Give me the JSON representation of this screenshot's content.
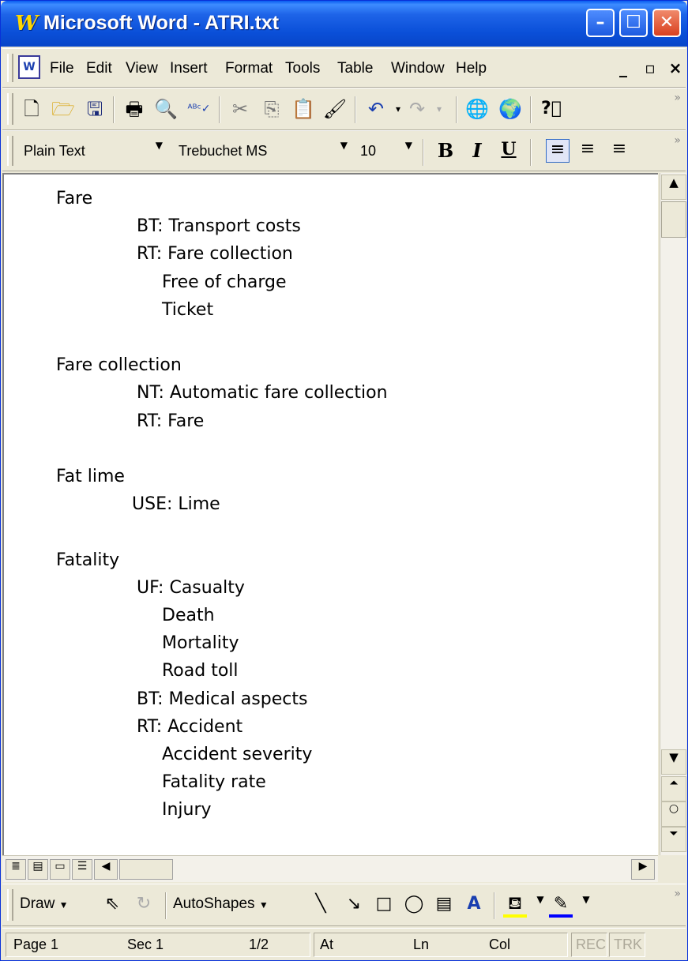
{
  "window": {
    "title": "Microsoft Word - ATRI.txt",
    "app_icon": "W",
    "controls": [
      "minimize-icon",
      "maximize-icon",
      "close-icon"
    ]
  },
  "menubar": {
    "doc_icon": "W",
    "items": [
      "File",
      "Edit",
      "View",
      "Insert",
      "Format",
      "Tools",
      "Table",
      "Window",
      "Help"
    ],
    "mdi_controls": [
      "_",
      "▫",
      "×"
    ]
  },
  "standard_toolbar": {
    "icons": [
      "new-icon",
      "open-icon",
      "save-icon",
      "print-icon",
      "print-preview-icon",
      "spelling-icon",
      "cut-icon",
      "copy-icon",
      "paste-icon",
      "format-painter-icon",
      "undo-icon",
      "redo-icon",
      "web-icon",
      "hyperlink-icon",
      "help-icon"
    ]
  },
  "formatting_toolbar": {
    "style": "Plain Text",
    "font": "Trebuchet MS",
    "size": "10",
    "bold": "B",
    "italic": "I",
    "underline": "U"
  },
  "document": {
    "lines": [
      {
        "text": "Fare",
        "level": 0
      },
      {
        "text": "BT: Transport costs",
        "level": 1
      },
      {
        "text": "RT: Fare collection",
        "level": 1
      },
      {
        "text": "Free of charge",
        "level": 2
      },
      {
        "text": "Ticket",
        "level": 2
      },
      {
        "text": "",
        "level": 0
      },
      {
        "text": "Fare collection",
        "level": 0
      },
      {
        "text": "NT: Automatic fare collection",
        "level": 1
      },
      {
        "text": "RT: Fare",
        "level": 1
      },
      {
        "text": "",
        "level": 0
      },
      {
        "text": "Fat lime",
        "level": 0
      },
      {
        "text": "USE: Lime",
        "level": 3
      },
      {
        "text": "",
        "level": 0
      },
      {
        "text": "Fatality",
        "level": 0
      },
      {
        "text": "UF: Casualty",
        "level": 1
      },
      {
        "text": "Death",
        "level": 2
      },
      {
        "text": "Mortality",
        "level": 2
      },
      {
        "text": "Road toll",
        "level": 2
      },
      {
        "text": "BT: Medical aspects",
        "level": 1
      },
      {
        "text": "RT: Accident",
        "level": 1
      },
      {
        "text": "Accident severity",
        "level": 2
      },
      {
        "text": "Fatality rate",
        "level": 2
      },
      {
        "text": "Injury",
        "level": 2
      }
    ]
  },
  "drawing_toolbar": {
    "draw_label": "Draw",
    "autoshapes_label": "AutoShapes"
  },
  "statusbar": {
    "page": "Page 1",
    "sec": "Sec 1",
    "pages": "1/2",
    "at": "At",
    "ln": "Ln",
    "col": "Col",
    "rec": "REC",
    "trk": "TRK"
  }
}
